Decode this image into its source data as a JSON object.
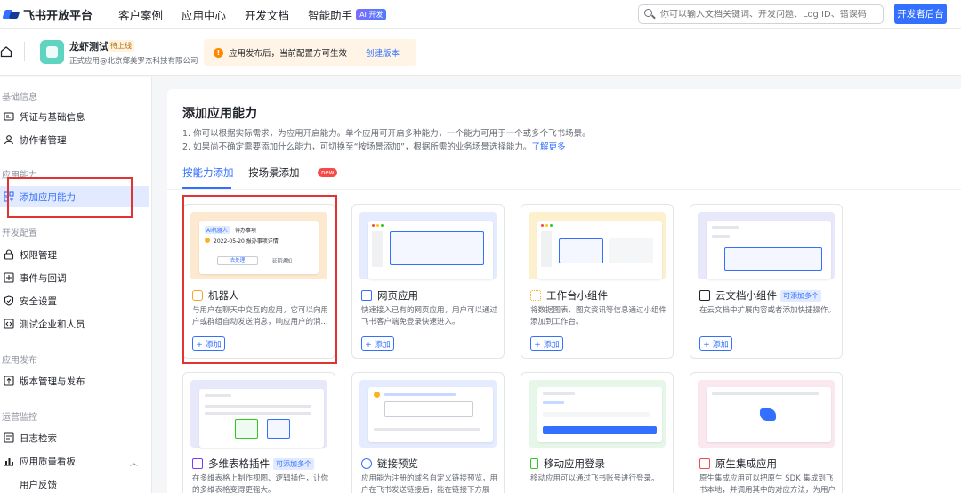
{
  "topnav": {
    "brand": "飞书开放平台",
    "links": [
      "客户案例",
      "应用中心",
      "开发文档",
      "智能助手"
    ],
    "ai_badge": "AI 开发",
    "search_placeholder": "你可以输入文档关键词、开发问题、Log ID、错误码",
    "dev_button": "开发者后台"
  },
  "app": {
    "name": "龙虾测试",
    "status_tag": "待上线",
    "subtitle": "正式应用@北京鄉美罗杰科技有限公司",
    "notice_text": "应用发布后，当前配置方可生效",
    "notice_link": "创建版本"
  },
  "sidebar": {
    "sections": [
      {
        "title": "基础信息",
        "items": [
          "凭证与基础信息",
          "协作者管理"
        ]
      },
      {
        "title": "应用能力",
        "items": [
          "添加应用能力"
        ]
      },
      {
        "title": "开发配置",
        "items": [
          "权限管理",
          "事件与回调",
          "安全设置",
          "测试企业和人员"
        ]
      },
      {
        "title": "应用发布",
        "items": [
          "版本管理与发布"
        ]
      },
      {
        "title": "运营监控",
        "items": [
          "日志检索",
          "应用质量看板",
          "用户反馈"
        ]
      }
    ]
  },
  "main": {
    "title": "添加应用能力",
    "desc1": "1. 你可以根据实际需求，为应用开启能力。单个应用可开启多种能力，一个能力可用于一个或多个飞书场景。",
    "desc2": "2. 如果尚不确定需要添加什么能力，可切换至“按场景添加”，根据所需的业务场景选择能力。",
    "desc2_link": "了解更多",
    "tabs": [
      "按能力添加",
      "按场景添加"
    ],
    "new_badge": "new",
    "add_label": "+ 添加",
    "cards": [
      {
        "title": "机器人",
        "tag": "",
        "desc": "与用户在聊天中交互的应用，它可以向用户或群组自动发送消息，响应用户的消..."
      },
      {
        "title": "网页应用",
        "tag": "",
        "desc": "快速接入已有的网页应用，用户可以通过飞书客户端免登录快速进入。"
      },
      {
        "title": "工作台小组件",
        "tag": "",
        "desc": "将数据图表、图文资讯等信息通过小组件添加到工作台。"
      },
      {
        "title": "云文档小组件",
        "tag": "可添加多个",
        "desc": "在云文档中扩展内容或者添加快捷操作。"
      },
      {
        "title": "多维表格插件",
        "tag": "可添加多个",
        "desc": "在多维表格上制作视图、逻辑插件，让你的多维表格变得更强大。"
      },
      {
        "title": "链接预览",
        "tag": "",
        "desc": "应用能为注册的域名自定义链接预览，用户在飞书发送链接后，能在链接下方展示..."
      },
      {
        "title": "移动应用登录",
        "tag": "",
        "desc": "移动应用可以通过飞书账号进行登录。"
      },
      {
        "title": "原生集成应用",
        "tag": "",
        "desc": "原生集成应用可以把原生 SDK 集成到飞书本地，并调用其中的对应方法，为用户提..."
      }
    ],
    "bot_mock": {
      "chip": "AI机器人",
      "chip2": "待办事项",
      "line": "2022-05-20 报办事项详情",
      "btn1": "去处理",
      "btn2": "延期通知"
    }
  },
  "colors": {
    "accent": "#3370ff",
    "highlight": "#e33232"
  }
}
